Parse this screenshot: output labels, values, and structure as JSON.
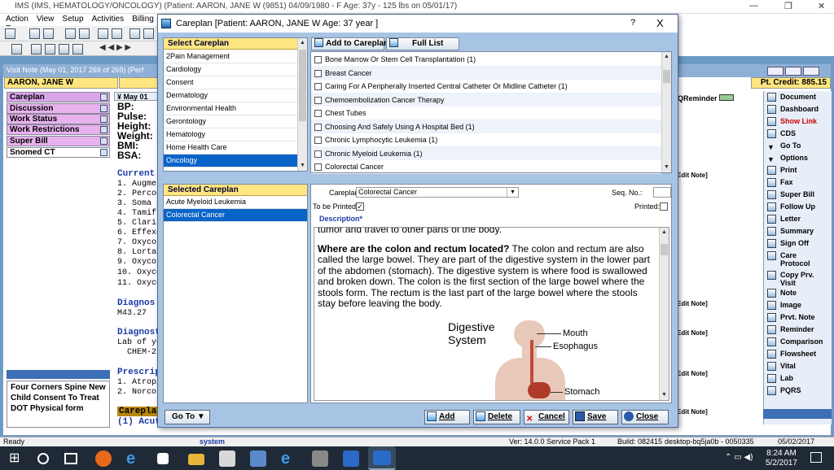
{
  "main_window": {
    "title": "IMS (IMS, HEMATOLOGY/ONCOLOGY)     (Patient: AARON, JANE W (9851) 04/09/1980 - F Age: 37y  - 125 lbs on 05/01/17)",
    "menu": [
      "Action",
      "View",
      "Setup",
      "Activities",
      "Billing",
      "R"
    ]
  },
  "visit_note": {
    "title": "Visit Note (May 01, 2017   269 of 269) (Perf",
    "patient_name": "AARON, JANE W",
    "date_label": "May 01",
    "credit": "Pt. Credit: 885.15",
    "qreminder": "QReminder",
    "left_nav": [
      {
        "label": "Careplan",
        "color": "#d9a6e8"
      },
      {
        "label": "Discussion",
        "color": "#e8b2ee"
      },
      {
        "label": "Work Status",
        "color": "#e8b2ee"
      },
      {
        "label": "Work Restrictions",
        "color": "#e8b2ee"
      },
      {
        "label": "Super Bill",
        "color": "#e8b2ee"
      },
      {
        "label": "Snomed CT",
        "color": "#ffffff"
      }
    ],
    "lower_list": [
      "Four Corners Spine New",
      "Child Consent To Treat",
      "DOT Physical form"
    ],
    "vitals": [
      "BP:",
      "Pulse:",
      "Height:",
      "Weight:",
      "BMI:",
      "BSA:"
    ],
    "current_head": "Current |",
    "meds": [
      "1. Augme",
      "2. Percoc",
      "3. Soma 2",
      "4. Tamiflu",
      "5. Claritin",
      "6. Effexor",
      "7. Oxycor",
      "8. Lortab",
      "9. Oxycor",
      "10. Oxyco",
      "11. Oxyco"
    ],
    "diagnosis_head": "Diagnos",
    "diagnosis_code": "M43.27",
    "diagnost_head": "Diagnost",
    "lab_line": "Lab of yo",
    "chem_line": "CHEM-2",
    "prescript_head": "Prescrip",
    "rx": [
      "1. Atropin",
      "2. Norco"
    ],
    "careplan_head": "Careplan",
    "careplan_item": "(1) Acute",
    "edit_note": "Edit Note]",
    "right_sidebar": [
      "Document",
      "Dashboard",
      "Show Link",
      "CDS",
      "Go To",
      "Options",
      "Print",
      "Fax",
      "Super Bill",
      "Follow Up",
      "Letter",
      "Summary",
      "Sign Off",
      "Care",
      "Protocol",
      "Copy Prv.",
      "Visit",
      "Note",
      "Image",
      "Prvt. Note",
      "Reminder",
      "Comparison",
      "Flowsheet",
      "Vital",
      "Lab",
      "PQRS"
    ]
  },
  "dialog": {
    "title": "Careplan  [Patient: AARON, JANE W  Age: 37 year ]",
    "help": "?",
    "close": "X",
    "select_careplan_head": "Select Careplan",
    "select_list": [
      "2Pain Management",
      "Cardiology",
      "Consent",
      "Dermatology",
      "Environmental Health",
      "Gerontology",
      "Hematology",
      "Home Health Care",
      "Oncology"
    ],
    "selected_index": 8,
    "add_to_careplan": "Add to Careplan",
    "full_list": "Full List",
    "careplan_options": [
      "Bone Marrow Or Stem Cell Transplantation (1)",
      "Breast Cancer",
      "Caring For A Peripherally Inserted Central Catheter Or Midline Catheter (1)",
      "Chemoembolization Cancer Therapy",
      "Chest Tubes",
      "Choosing And Safely Using A Hospital Bed (1)",
      "Chronic Lymphocytic Leukemia (1)",
      "Chronic Myeloid Leukemia (1)",
      "Colorectal Cancer"
    ],
    "selected_careplan_head": "Selected Careplan",
    "selected_careplans": [
      "Acute Myeloid Leukemia",
      "Colorectal Cancer"
    ],
    "careplan_label": "Careplan*",
    "careplan_value": "Colorectal Cancer",
    "seq_label": "Seq. No.:",
    "to_be_printed_label": "To be Printed:",
    "printed_label": "Printed:",
    "description_label": "Description*",
    "desc_top": "tumor and travel to other parts of the body.",
    "desc_q": "Where are the colon and rectum located?",
    "desc_body": " The colon and rectum are also called the large bowel. They are part of the digestive system in the lower part of the abdomen (stomach). The digestive system is where food is swallowed and broken down. The colon is the first section of the large bowel where the stools form. The rectum is the last part of the large bowel where the stools stay before leaving the body.",
    "figure": {
      "title1": "Digestive",
      "title2": "System",
      "mouth": "Mouth",
      "esophagus": "Esophagus",
      "stomach": "Stomach"
    },
    "goto": "Go To",
    "buttons": {
      "add": "Add",
      "delete": "Delete",
      "cancel": "Cancel",
      "save": "Save",
      "close": "Close"
    }
  },
  "status": {
    "ready": "Ready",
    "user": "system",
    "version": "Ver: 14.0.0 Service Pack 1",
    "build": "Build: 082415",
    "machine": "desktop-bq5ja0b - 0050335",
    "date": "05/02/2017"
  },
  "taskbar": {
    "time": "8:24 AM",
    "date": "5/2/2017"
  }
}
